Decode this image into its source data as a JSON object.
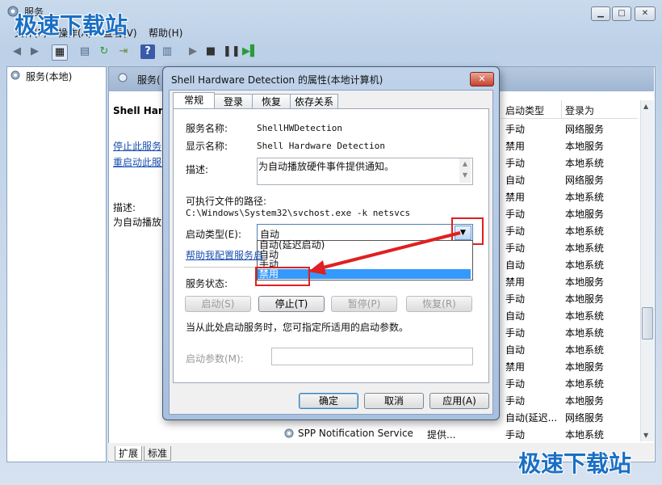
{
  "window": {
    "title": "服务",
    "menu": [
      "文件(F)",
      "操作(A)",
      "查看(V)",
      "帮助(H)"
    ],
    "left_tree_item": "服务(本地)",
    "right_header": "服务(",
    "left_panel_name": "Shell Hard",
    "left_links": [
      "停止此服务",
      "重启动此服务"
    ],
    "desc_label": "描述:",
    "desc_text": "为自动播放",
    "bottom_tabs": [
      "扩展",
      "标准"
    ],
    "visible_service_name": "SPP Notification Service",
    "visible_service_desc": "提供..."
  },
  "columns": {
    "startup": "启动类型",
    "logon": "登录为"
  },
  "rows": [
    {
      "startup": "手动",
      "logon": "网络服务"
    },
    {
      "startup": "禁用",
      "logon": "本地服务"
    },
    {
      "startup": "手动",
      "logon": "本地系统"
    },
    {
      "startup": "自动",
      "logon": "网络服务"
    },
    {
      "startup": "禁用",
      "logon": "本地系统"
    },
    {
      "startup": "手动",
      "logon": "本地服务"
    },
    {
      "startup": "手动",
      "logon": "本地系统"
    },
    {
      "startup": "手动",
      "logon": "本地系统"
    },
    {
      "startup": "自动",
      "logon": "本地系统"
    },
    {
      "startup": "禁用",
      "logon": "本地服务"
    },
    {
      "startup": "手动",
      "logon": "本地服务"
    },
    {
      "startup": "自动",
      "logon": "本地系统"
    },
    {
      "startup": "手动",
      "logon": "本地系统"
    },
    {
      "startup": "自动",
      "logon": "本地系统"
    },
    {
      "startup": "禁用",
      "logon": "本地服务"
    },
    {
      "startup": "手动",
      "logon": "本地系统"
    },
    {
      "startup": "手动",
      "logon": "本地服务"
    },
    {
      "startup": "自动(延迟...",
      "logon": "网络服务"
    },
    {
      "startup": "手动",
      "logon": "本地系统"
    }
  ],
  "dialog": {
    "title": "Shell Hardware Detection 的属性(本地计算机)",
    "tabs": [
      "常规",
      "登录",
      "恢复",
      "依存关系"
    ],
    "service_name_label": "服务名称:",
    "service_name": "ShellHWDetection",
    "display_name_label": "显示名称:",
    "display_name": "Shell Hardware Detection",
    "description_label": "描述:",
    "description": "为自动播放硬件事件提供通知。",
    "path_label": "可执行文件的路径:",
    "path": "C:\\Windows\\System32\\svchost.exe -k netsvcs",
    "startup_label": "启动类型(E):",
    "startup_value": "自动",
    "startup_options": [
      "自动(延迟启动)",
      "自动",
      "手动",
      "禁用"
    ],
    "help_link": "帮助我配置服务启",
    "status_label": "服务状态:",
    "btn_start": "启动(S)",
    "btn_stop": "停止(T)",
    "btn_pause": "暂停(P)",
    "btn_resume": "恢复(R)",
    "hint": "当从此处启动服务时，您可指定所适用的启动参数。",
    "params_label": "启动参数(M):",
    "ok": "确定",
    "cancel": "取消",
    "apply": "应用(A)"
  },
  "watermark": "极速下载站",
  "colors": {
    "highlight": "#3399ff",
    "annotation_red": "#e02020",
    "watermark": "#1a6fc4"
  }
}
